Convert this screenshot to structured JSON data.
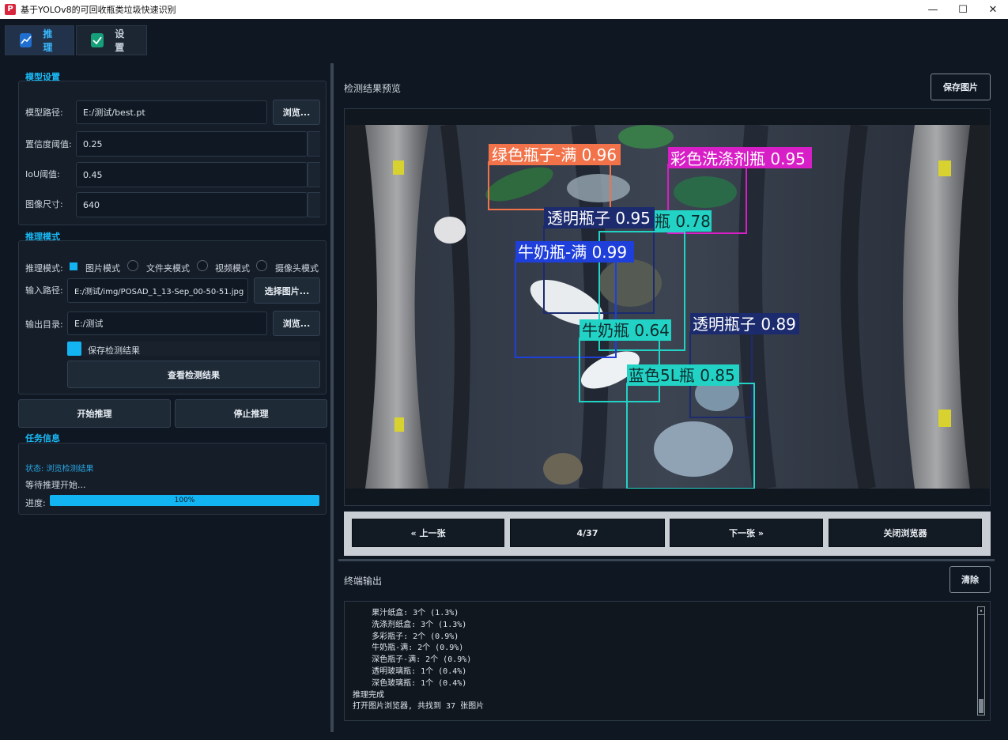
{
  "window": {
    "title": "基于YOLOv8的可回收瓶类垃圾快速识别",
    "min": "—",
    "max": "☐",
    "close": "✕"
  },
  "tabs": [
    {
      "label": "推理",
      "icon": "chart-icon"
    },
    {
      "label": "设置",
      "icon": "check-icon"
    }
  ],
  "model_settings": {
    "title": "模型设置",
    "model_path_label": "模型路径:",
    "model_path": "E:/测试/best.pt",
    "browse": "浏览...",
    "conf_label": "置信度阈值:",
    "conf": "0.25",
    "iou_label": "IoU阈值:",
    "iou": "0.45",
    "size_label": "图像尺寸:",
    "size": "640"
  },
  "inference_mode": {
    "title": "推理模式",
    "mode_label": "推理模式:",
    "modes": [
      "图片模式",
      "文件夹模式",
      "视频模式",
      "摄像头模式"
    ],
    "input_label": "输入路径:",
    "input_path": "E:/测试/img/POSAD_1_13-Sep_00-50-51.jpg",
    "select_image": "选择图片...",
    "output_label": "输出目录:",
    "output_path": "E:/测试",
    "browse": "浏览...",
    "save_results": "保存检测结果",
    "view_results": "查看检测结果"
  },
  "actions": {
    "start": "开始推理",
    "stop": "停止推理"
  },
  "task_info": {
    "title": "任务信息",
    "status": "状态: 浏览检测结果",
    "waiting": "等待推理开始...",
    "progress_label": "进度:",
    "progress_text": "100%",
    "progress_value": 100
  },
  "preview": {
    "title": "检测结果预览",
    "save_image": "保存图片",
    "detections": [
      {
        "label": "绿色瓶子-满 0.96",
        "color": "#f2734a"
      },
      {
        "label": "彩色洗涤剂瓶 0.95",
        "color": "#d81ec6"
      },
      {
        "label": "透明瓶子 0.95",
        "color": "#1c2b6e"
      },
      {
        "label": "瓶 0.78",
        "color": "#22d3c5"
      },
      {
        "label": "牛奶瓶-满 0.99",
        "color": "#1f3fdb"
      },
      {
        "label": "透明瓶子 0.89",
        "color": "#1c2b6e"
      },
      {
        "label": "牛奶瓶 0.64",
        "color": "#22d3c5"
      },
      {
        "label": "蓝色5L瓶 0.85",
        "color": "#22d3c5"
      }
    ]
  },
  "navigation": {
    "prev": "« 上一张",
    "counter": "4/37",
    "next": "下一张 »",
    "close": "关闭浏览器"
  },
  "terminal": {
    "title": "终端输出",
    "clear": "清除",
    "lines": [
      "    果汁纸盒: 3个 (1.3%)",
      "    洗涤剂纸盒: 3个 (1.3%)",
      "    多彩瓶子: 2个 (0.9%)",
      "    牛奶瓶-满: 2个 (0.9%)",
      "    深色瓶子-满: 2个 (0.9%)",
      "    透明玻璃瓶: 1个 (0.4%)",
      "    深色玻璃瓶: 1个 (0.4%)",
      "推理完成",
      "打开图片浏览器, 共找到 37 张图片"
    ]
  }
}
